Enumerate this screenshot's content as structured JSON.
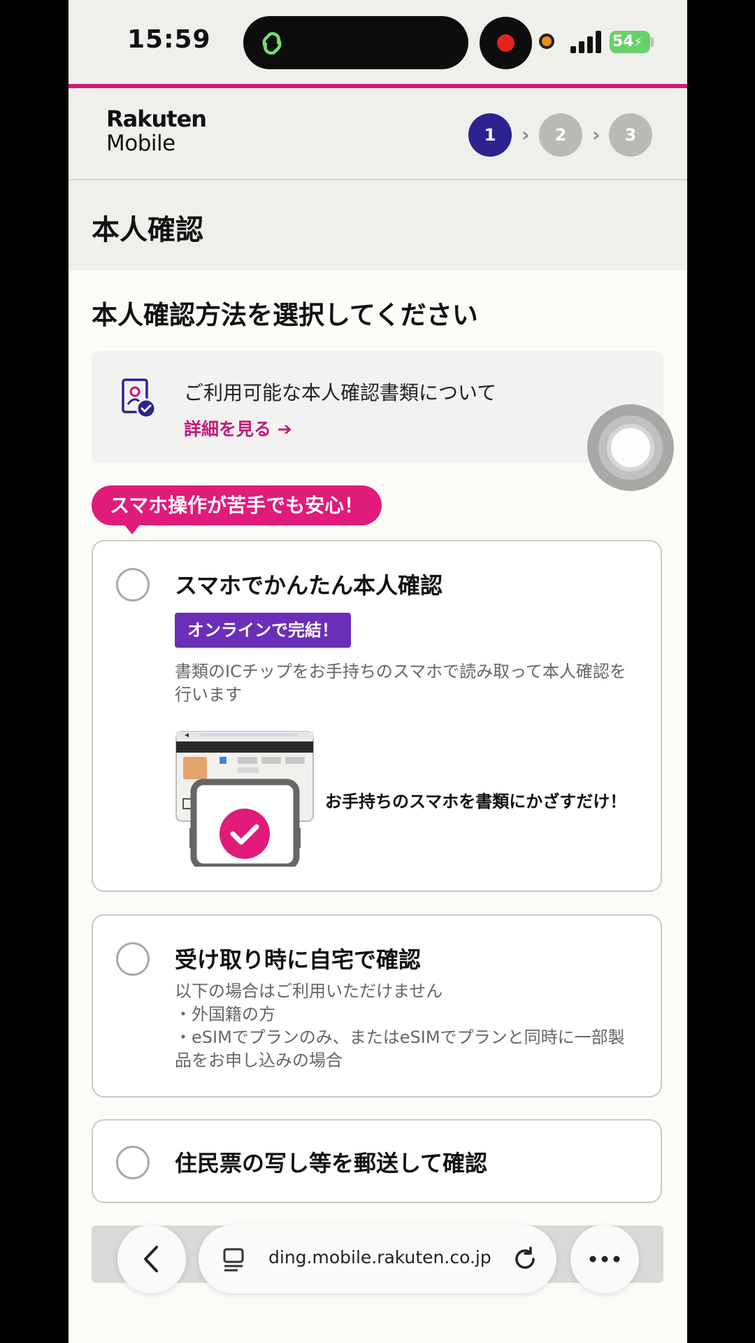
{
  "status_bar": {
    "time": "15:59",
    "battery": "54"
  },
  "header": {
    "logo_line1": "Rakuten",
    "logo_line2": "Mobile",
    "steps": [
      "1",
      "2",
      "3"
    ],
    "active_step": 1
  },
  "page_title": "本人確認",
  "section_title": "本人確認方法を選択してください",
  "info": {
    "text": "ご利用可能な本人確認書類について",
    "link": "詳細を見る ➔"
  },
  "tag": "スマホ操作が苦手でも安心！",
  "options": [
    {
      "title": "スマホでかんたん本人確認",
      "badge": "オンラインで完結！",
      "desc_line1": "書類のICチップをお手持ちのスマホで読み取って本人確認を",
      "desc_line2": "行います",
      "illus_caption": "お手持ちのスマホを書類にかざすだけ！"
    },
    {
      "title": "受け取り時に自宅で確認",
      "desc_line1": "以下の場合はご利用いただけません",
      "desc_line2": "・外国籍の方",
      "desc_line3": "・eSIMでプランのみ、またはeSIMでプランと同時に一部製",
      "desc_line4": "品をお申し込みの場合"
    },
    {
      "title": "住民票の写し等を郵送して確認"
    }
  ],
  "browser": {
    "url": "ding.mobile.rakuten.co.jp"
  },
  "colors": {
    "brand_pink": "#d41877",
    "step_active": "#2d2390",
    "badge_purple": "#6a2fb8",
    "link_pink": "#c4187a"
  }
}
